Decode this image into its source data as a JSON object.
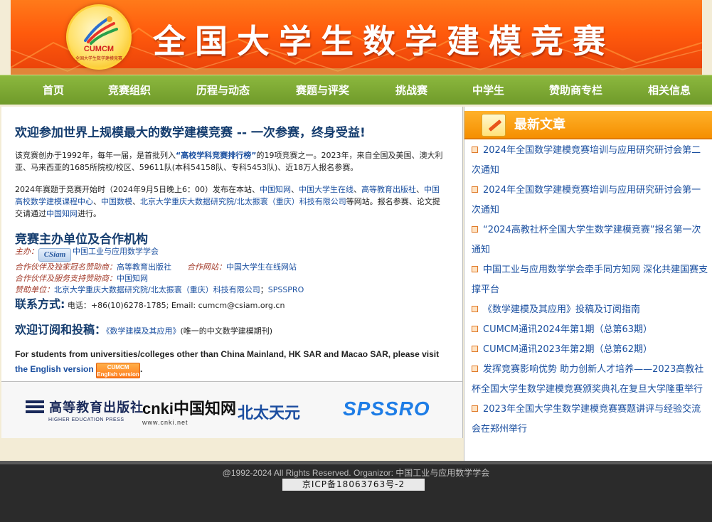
{
  "banner": {
    "logo_text": "CUMCM",
    "logo_ring_text": "全国大学生数学建模竞赛",
    "title": "全国大学生数学建模竞赛"
  },
  "nav": {
    "items": [
      "首页",
      "竞赛组织",
      "历程与动态",
      "赛题与评奖",
      "挑战赛",
      "中学生",
      "赞助商专栏",
      "相关信息"
    ]
  },
  "main": {
    "headline": "欢迎参加世界上规模最大的数学建模竞赛 -- 一次参赛，终身受益!",
    "intro": {
      "text_a": "该竞赛创办于1992年，每年一届，是首批列入",
      "ranking_link": "“高校学科竞赛排行榜”",
      "text_b": "的19项竞赛之一。2023年，来自全国及美国、澳大利亚、马来西亚的1685所院校/校区、59611队(本科54158队、专科5453队)、近18万人报名参赛。"
    },
    "schedule": {
      "text_a": "2024年赛题于竞赛开始时（2024年9月5日晚上6：00）发布在本站、",
      "link_1": "中国知网",
      "sep_1": "、",
      "link_2": "中国大学生在线",
      "sep_2": "、",
      "link_3": "高等教育出版社",
      "sep_3": "、",
      "link_4": "中国高校数学建模课程中心",
      "sep_4": "、",
      "link_5": "中国数模",
      "sep_5": "、",
      "link_6": "北京大学重庆大数据研究院/北太振寰（重庆）科技有限公司",
      "text_b": "等网站。报名参赛、论文提交请通过",
      "link_7": "中国知网",
      "text_c": "进行。"
    },
    "organizers": {
      "heading": "竞赛主办单位及合作机构",
      "host_label": "主办：",
      "csiam_logo": "CSiam",
      "host_link": "中国工业与应用数学学会",
      "partner_label": "合作伙伴及独家冠名赞助商：",
      "partner_link": "高等教育出版社",
      "website_label": "合作网站：",
      "website_link": "中国大学生在线网站",
      "service_label": "合作伙伴及服务支持赞助商：",
      "service_link": "中国知网",
      "sponsor_label": "赞助单位：",
      "sponsor_link_1": "北京大学重庆大数据研究院/北太振寰（重庆）科技有限公司",
      "sponsor_sep": "；",
      "sponsor_link_2": "SPSSPRO"
    },
    "contact": {
      "heading": "联系方式:",
      "text": " 电话：+86(10)6278-1785; Email: cumcm@csiam.org.cn"
    },
    "subscribe": {
      "heading": "欢迎订阅和投稿：",
      "link": "《数学建模及其应用》",
      "text": "(唯一的中文数学建模期刊)"
    },
    "english": {
      "text": "For students from universities/colleges other than China Mainland, HK SAR and Macao SAR, please visit",
      "link": "the English version",
      "badge_line1": "CUMCM",
      "badge_line2": "English version",
      "tail": "."
    }
  },
  "sponsors": {
    "hep_cn": "高等教育出版社",
    "hep_en": "HIGHER EDUCATION PRESS",
    "cnki_main": "cnki中国知网",
    "cnki_url": "www.cnki.net",
    "pku": "北太天元",
    "spss": "SPSSRO"
  },
  "sidebar": {
    "title": "最新文章",
    "articles": [
      "2024年全国数学建模竞赛培训与应用研究研讨会第二次通知",
      "2024年全国数学建模竞赛培训与应用研究研讨会第一次通知",
      "“2024高教社杯全国大学生数学建模竞赛”报名第一次通知",
      "中国工业与应用数学学会牵手同方知网 深化共建国赛支撑平台",
      "《数学建模及其应用》投稿及订阅指南",
      "CUMCM通讯2024年第1期（总第63期）",
      "CUMCM通讯2023年第2期（总第62期）",
      "发挥竞赛影响优势 助力创新人才培养——2023高教社杯全国大学生数学建模竞赛颁奖典礼在复旦大学隆重举行",
      "2023年全国大学生数学建模竞赛赛题讲评与经验交流会在郑州举行"
    ]
  },
  "footer": {
    "copyright": "@1992-2024 All Rights Reserved.    Organizor: 中国工业与应用数学学会",
    "icp": "京ICP备18063763号-2"
  },
  "colors": {
    "banner_orange": "#ff5a0c",
    "nav_green": "#7aa532",
    "link_blue": "#1a4fa0",
    "heading_navy": "#143c6e",
    "sidebar_header": "#f58f00",
    "footer_dark": "#2b2b2b"
  }
}
